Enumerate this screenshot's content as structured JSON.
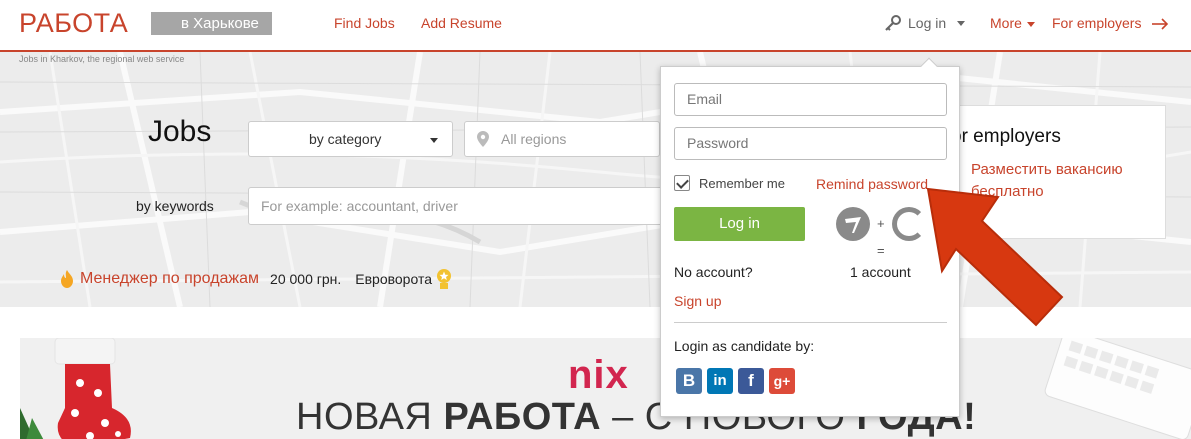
{
  "header": {
    "logo": "РАБОТА",
    "city": "в Харькове",
    "tagline": "Jobs in Kharkov, the regional web service",
    "nav": {
      "find_jobs": "Find Jobs",
      "add_resume": "Add Resume",
      "login": "Log in",
      "more": "More",
      "for_employers": "For employers"
    }
  },
  "search": {
    "title": "Jobs",
    "category_select": "by category",
    "region_placeholder": "All regions",
    "keywords_label": "by keywords",
    "keywords_placeholder": "For example: accountant, driver"
  },
  "promo": {
    "title": "Менеджер по продажам",
    "salary": "20 000 грн.",
    "company": "Евроворота"
  },
  "employers_card": {
    "heading": "or employers",
    "link": "Разместить вакансию бесплатно"
  },
  "login_dropdown": {
    "email_placeholder": "Email",
    "password_placeholder": "Password",
    "remember_me": "Remember me",
    "remind_password": "Remind password",
    "login_button": "Log in",
    "plus_sign": "+",
    "equals_sign": "=",
    "no_account": "No account?",
    "one_account": "1 account",
    "sign_up": "Sign up",
    "candidate_label": "Login as candidate by:",
    "socials": [
      {
        "name": "vk",
        "glyph": "B",
        "color": "#4a76a8"
      },
      {
        "name": "linkedin",
        "glyph": "in",
        "color": "#0077b5"
      },
      {
        "name": "facebook",
        "glyph": "f",
        "color": "#3b5998"
      },
      {
        "name": "google-plus",
        "glyph": "g+",
        "color": "#dd4b39"
      }
    ]
  },
  "banner": {
    "brand": "nix",
    "text_light1": "НОВАЯ ",
    "text_bold1": "РАБОТА",
    "text_light2": " – С НОВОГО ",
    "text_bold2": "ГОДА!"
  },
  "colors": {
    "accent": "#c8442c",
    "login_green": "#7bb543"
  }
}
